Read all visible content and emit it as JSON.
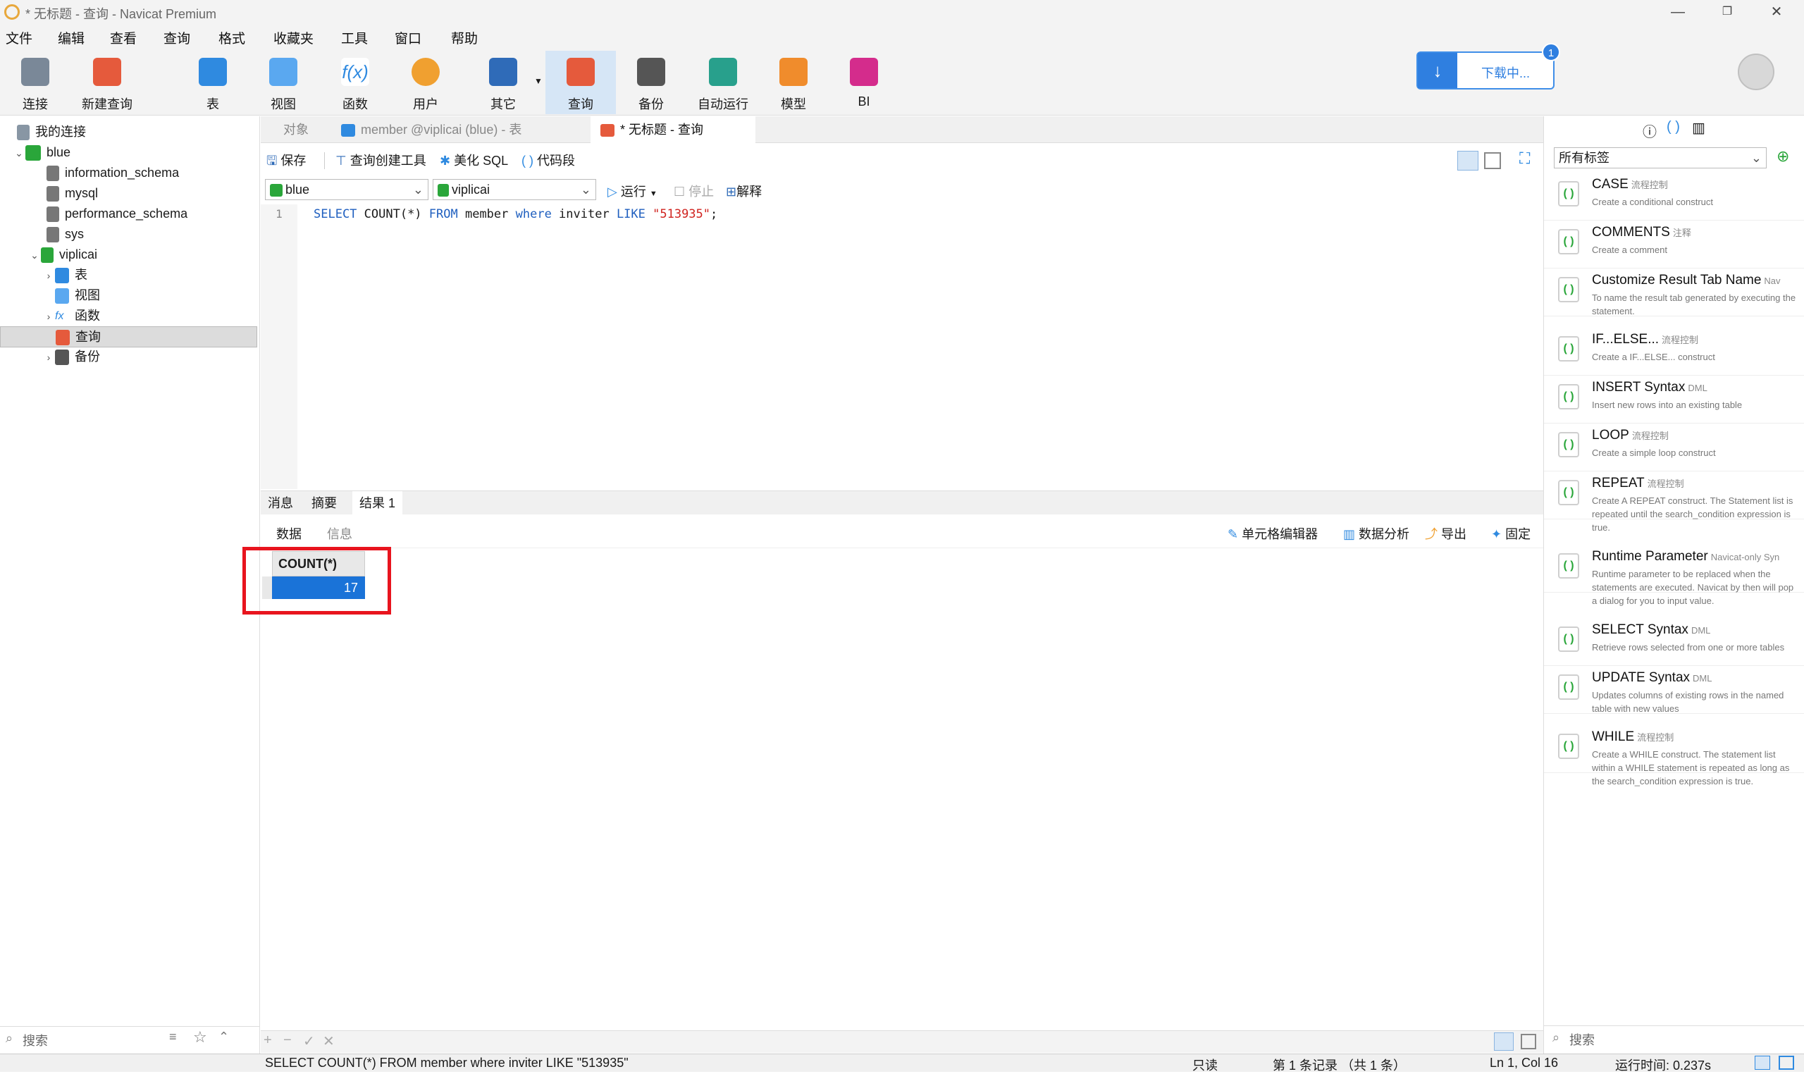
{
  "window": {
    "title": "* 无标题 - 查询 - Navicat Premium",
    "minimize": "—",
    "maximize": "❐",
    "close": "✕"
  },
  "menu": [
    "文件",
    "编辑",
    "查看",
    "查询",
    "格式",
    "收藏夹",
    "工具",
    "窗口",
    "帮助"
  ],
  "toolbar": {
    "items": [
      {
        "label": "连接",
        "icon": "connect-icon",
        "color": "#6a7a8a"
      },
      {
        "label": "新建查询",
        "icon": "new-query-icon",
        "color": "#e55a3c"
      },
      {
        "label": "表",
        "icon": "table-icon",
        "color": "#2f8ae0"
      },
      {
        "label": "视图",
        "icon": "view-icon",
        "color": "#2f8ae0"
      },
      {
        "label": "函数",
        "icon": "function-icon",
        "color": "#2f8ae0"
      },
      {
        "label": "用户",
        "icon": "user-icon",
        "color": "#f0a030"
      },
      {
        "label": "其它",
        "icon": "other-icon",
        "color": "#2f6bb8"
      },
      {
        "label": "查询",
        "icon": "query-icon",
        "color": "#e55a3c"
      },
      {
        "label": "备份",
        "icon": "backup-icon",
        "color": "#555"
      },
      {
        "label": "自动运行",
        "icon": "robot-icon",
        "color": "#28a08c"
      },
      {
        "label": "模型",
        "icon": "model-icon",
        "color": "#f08c2c"
      },
      {
        "label": "BI",
        "icon": "bi-icon",
        "color": "#d42c8c"
      }
    ],
    "download_label": "下载中...",
    "download_badge": "1"
  },
  "tree": {
    "root": "我的连接",
    "conn_blue": "blue",
    "dbs": [
      "information_schema",
      "mysql",
      "performance_schema",
      "sys"
    ],
    "db_viplicai": "viplicai",
    "children": [
      "表",
      "视图",
      "函数",
      "查询",
      "备份"
    ]
  },
  "left_search_placeholder": "搜索",
  "tabs": {
    "objects": "对象",
    "member": "member @viplicai (blue) - 表",
    "query": "* 无标题 - 查询"
  },
  "query_toolbar": {
    "save": "保存",
    "builder": "查询创建工具",
    "beautify": "美化 SQL",
    "snippet": "代码段"
  },
  "selectors": {
    "connection": "blue",
    "database": "viplicai",
    "run": "运行",
    "stop": "停止",
    "explain": "解释"
  },
  "editor": {
    "line": "1",
    "sql_kw1": "SELECT",
    "sql_fn": " COUNT(*) ",
    "sql_kw2": "FROM",
    "sql_tbl": " member ",
    "sql_kw3": "where",
    "sql_col": " inviter ",
    "sql_kw4": "LIKE",
    "sql_str": " \"513935\"",
    "sql_end": ";"
  },
  "result_tabs": {
    "messages": "消息",
    "summary": "摘要",
    "result1": "结果 1"
  },
  "sub_tabs": {
    "data": "数据",
    "info": "信息",
    "cell_editor": "单元格编辑器",
    "analysis": "数据分析",
    "export": "导出",
    "pin": "固定"
  },
  "grid": {
    "column": "COUNT(*)",
    "value": "17"
  },
  "snippets_filter": "所有标签",
  "snippets": [
    {
      "title": "CASE",
      "tag": "流程控制",
      "desc": "Create a conditional construct"
    },
    {
      "title": "COMMENTS",
      "tag": "注释",
      "desc": "Create a comment"
    },
    {
      "title": "Customize Result Tab Name",
      "tag": "Nav",
      "desc": "To name the result tab generated by executing the statement."
    },
    {
      "title": "IF...ELSE...",
      "tag": "流程控制",
      "desc": "Create a IF...ELSE... construct"
    },
    {
      "title": "INSERT Syntax",
      "tag": "DML",
      "desc": "Insert new rows into an existing table"
    },
    {
      "title": "LOOP",
      "tag": "流程控制",
      "desc": "Create a simple loop construct"
    },
    {
      "title": "REPEAT",
      "tag": "流程控制",
      "desc": "Create A REPEAT construct. The Statement list is repeated until the search_condition expression is true."
    },
    {
      "title": "Runtime Parameter",
      "tag": "Navicat-only Syn",
      "desc": "Runtime parameter to be replaced when the statements are executed. Navicat by then will pop a dialog for you to input value."
    },
    {
      "title": "SELECT Syntax",
      "tag": "DML",
      "desc": "Retrieve rows selected from one or more tables"
    },
    {
      "title": "UPDATE Syntax",
      "tag": "DML",
      "desc": "Updates columns of existing rows in the named table with new values"
    },
    {
      "title": "WHILE",
      "tag": "流程控制",
      "desc": "Create a WHILE construct. The statement list within a WHILE statement is repeated as long as the search_condition expression is true."
    }
  ],
  "right_search_placeholder": "搜索",
  "status": {
    "sql": "SELECT COUNT(*) FROM member where inviter LIKE \"513935\"",
    "readonly": "只读",
    "records": "第 1 条记录 （共 1 条）",
    "position": "Ln 1, Col 16",
    "runtime": "运行时间: 0.237s"
  }
}
